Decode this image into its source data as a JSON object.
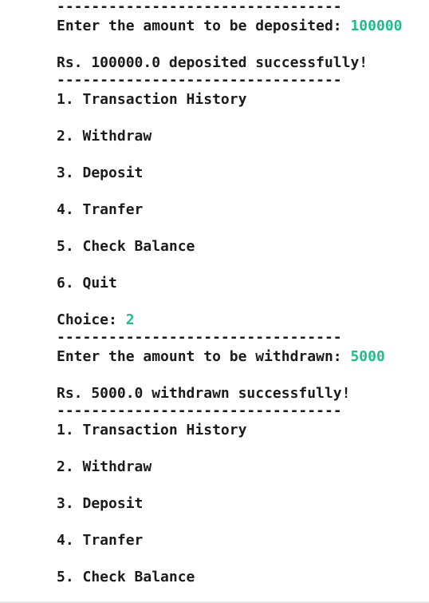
{
  "colors": {
    "text": "#1b1b1b",
    "input": "#1cbf8c",
    "background": "#ffffff"
  },
  "console": {
    "separator": "---------------------------------",
    "deposit_prompt": "Enter the amount to be deposited: ",
    "deposit_input": "100000",
    "deposit_result": "Rs. 100000.0 deposited successfully!",
    "menu_1": {
      "item1": "1. Transaction History",
      "item2": "2. Withdraw",
      "item3": "3. Deposit",
      "item4": "4. Tranfer",
      "item5": "5. Check Balance",
      "item6": "6. Quit"
    },
    "choice_prompt": "Choice: ",
    "choice_input": "2",
    "withdraw_prompt": "Enter the amount to be withdrawn: ",
    "withdraw_input": "5000",
    "withdraw_result": "Rs. 5000.0 withdrawn successfully!",
    "menu_2": {
      "item1": "1. Transaction History",
      "item2": "2. Withdraw",
      "item3": "3. Deposit",
      "item4": "4. Tranfer",
      "item5": "5. Check Balance"
    }
  }
}
